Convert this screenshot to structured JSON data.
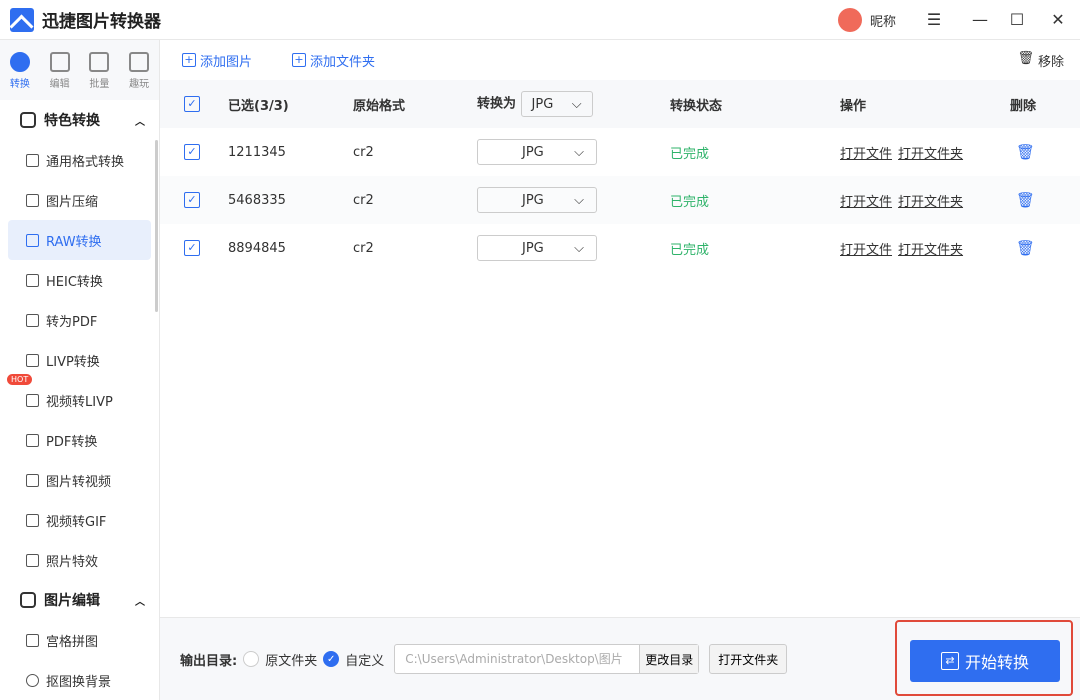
{
  "app": {
    "title": "迅捷图片转换器",
    "user": "昵称"
  },
  "tabs": [
    "转换",
    "编辑",
    "批量",
    "趣玩"
  ],
  "sidebar": {
    "group1": "特色转换",
    "items": [
      "通用格式转换",
      "图片压缩",
      "RAW转换",
      "HEIC转换",
      "转为PDF",
      "LIVP转换",
      "视频转LIVP",
      "PDF转换",
      "图片转视频",
      "视频转GIF",
      "照片特效"
    ],
    "hot": "HOT",
    "group2": "图片编辑",
    "items2": [
      "宫格拼图",
      "抠图换背景"
    ]
  },
  "toolbar": {
    "add_image": "添加图片",
    "add_folder": "添加文件夹",
    "remove": "移除"
  },
  "table": {
    "headers": {
      "selected": "已选(3/3)",
      "format": "原始格式",
      "convert_to": "转换为",
      "convert_to_value": "JPG",
      "status": "转换状态",
      "actions": "操作",
      "delete": "删除"
    },
    "rows": [
      {
        "name": "1211345",
        "format": "cr2",
        "target": "JPG",
        "status": "已完成",
        "open_file": "打开文件",
        "open_folder": "打开文件夹"
      },
      {
        "name": "5468335",
        "format": "cr2",
        "target": "JPG",
        "status": "已完成",
        "open_file": "打开文件",
        "open_folder": "打开文件夹"
      },
      {
        "name": "8894845",
        "format": "cr2",
        "target": "JPG",
        "status": "已完成",
        "open_file": "打开文件",
        "open_folder": "打开文件夹"
      }
    ]
  },
  "footer": {
    "label": "输出目录:",
    "opt1": "原文件夹",
    "opt2": "自定义",
    "path": "C:\\Users\\Administrator\\Desktop\\图片",
    "change": "更改目录",
    "open": "打开文件夹",
    "start": "开始转换"
  }
}
